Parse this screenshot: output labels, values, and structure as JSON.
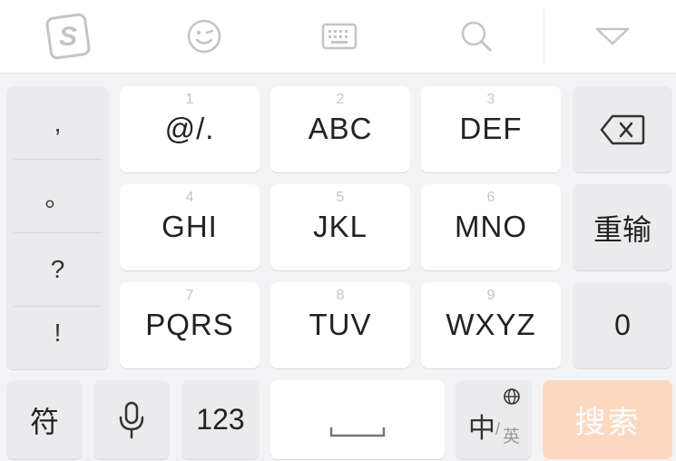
{
  "toolbar": {
    "icons": [
      "sogou-logo-icon",
      "emoji-icon",
      "keyboard-icon",
      "search-icon",
      "collapse-icon"
    ]
  },
  "symbols": [
    ",",
    "。",
    "?",
    "!"
  ],
  "keys": [
    {
      "num": "1",
      "label": "@/."
    },
    {
      "num": "2",
      "label": "ABC"
    },
    {
      "num": "3",
      "label": "DEF"
    },
    {
      "num": "4",
      "label": "GHI"
    },
    {
      "num": "5",
      "label": "JKL"
    },
    {
      "num": "6",
      "label": "MNO"
    },
    {
      "num": "7",
      "label": "PQRS"
    },
    {
      "num": "8",
      "label": "TUV"
    },
    {
      "num": "9",
      "label": "WXYZ"
    }
  ],
  "right_col": {
    "retype": "重输",
    "zero": "0"
  },
  "bottom": {
    "symbol": "符",
    "numbers": "123",
    "lang_main": "中",
    "lang_sep": "/",
    "lang_sub": "英",
    "search": "搜索"
  },
  "colors": {
    "accent": "#fdd8c0",
    "key": "#ffffff",
    "function_key": "#ebebed",
    "background": "#f3f3f5"
  }
}
